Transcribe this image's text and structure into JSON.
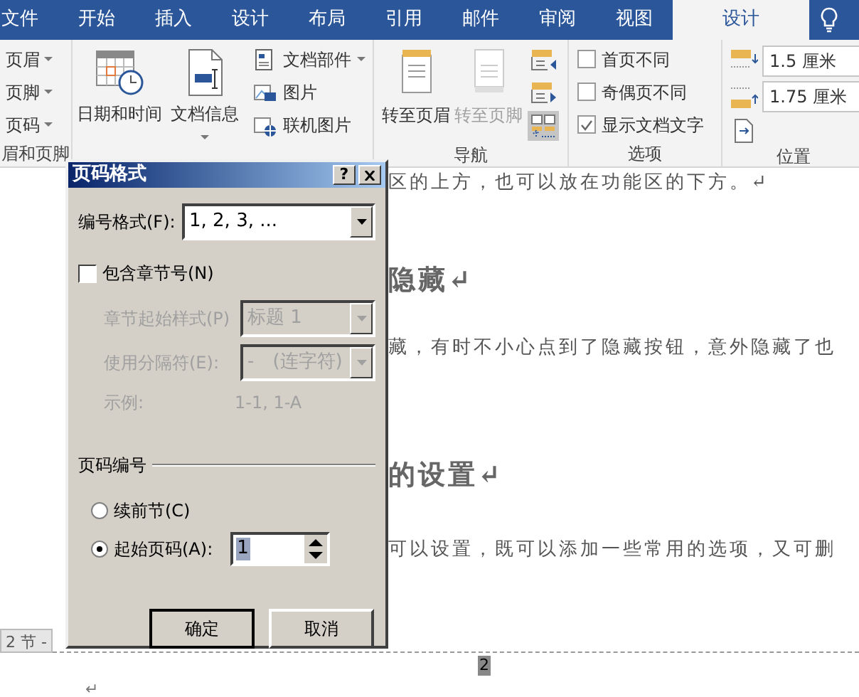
{
  "ribbon_tabs": [
    {
      "label": "文件",
      "selected": false
    },
    {
      "label": "开始",
      "selected": false
    },
    {
      "label": "插入",
      "selected": false
    },
    {
      "label": "设计",
      "selected": false
    },
    {
      "label": "布局",
      "selected": false
    },
    {
      "label": "引用",
      "selected": false
    },
    {
      "label": "邮件",
      "selected": false
    },
    {
      "label": "审阅",
      "selected": false
    },
    {
      "label": "视图",
      "selected": false
    },
    {
      "label": "设计",
      "selected": true
    }
  ],
  "header_footer_group": {
    "label": "眉和页脚",
    "items": [
      {
        "label": "页眉"
      },
      {
        "label": "页脚"
      },
      {
        "label": "页码"
      }
    ]
  },
  "insert_group": {
    "large_buttons": [
      {
        "label": "日期和时间",
        "dropdown": false
      },
      {
        "label": "文档信息",
        "dropdown": true
      }
    ],
    "small_buttons": [
      {
        "label": "文档部件",
        "dropdown": true
      },
      {
        "label": "图片",
        "dropdown": false
      },
      {
        "label": "联机图片",
        "dropdown": false
      }
    ]
  },
  "navigation_group": {
    "label": "导航",
    "buttons": [
      {
        "label": "转至页眉",
        "disabled": false
      },
      {
        "label": "转至页脚",
        "disabled": true
      }
    ],
    "small_buttons": [
      {
        "on": false
      },
      {
        "on": false
      },
      {
        "on": true
      }
    ]
  },
  "options_group": {
    "label": "选项",
    "checkboxes": [
      {
        "label": "首页不同",
        "checked": false
      },
      {
        "label": "奇偶页不同",
        "checked": false
      },
      {
        "label": "显示文档文字",
        "checked": true
      }
    ]
  },
  "position_group": {
    "label": "位置",
    "fields": [
      {
        "value": "1.5 厘米"
      },
      {
        "value": "1.75 厘米"
      }
    ]
  },
  "document": {
    "lines": [
      {
        "kind": "body",
        "text": "区的上方，也可以放在功能区的下方。↵"
      },
      {
        "kind": "heading",
        "text": "隐藏↵"
      },
      {
        "kind": "body",
        "text": "藏，有时不小心点到了隐藏按钮，意外隐藏了也"
      },
      {
        "kind": "heading",
        "text": "的设置↵"
      },
      {
        "kind": "body",
        "text": "可以设置，既可以添加一些常用的选项，又可删"
      }
    ],
    "footer": {
      "section_label": "2 节 -",
      "page_number": "2",
      "paragraph_mark": "↵"
    }
  },
  "dialog": {
    "title": "页码格式",
    "help": "?",
    "number_format": {
      "label": "编号格式(F):",
      "value": "1, 2, 3, ..."
    },
    "include_chapter": {
      "label": "包含章节号(N)",
      "checked": false
    },
    "chapter_style": {
      "label": "章节起始样式(P)",
      "value": "标题 1",
      "disabled": true
    },
    "separator": {
      "label": "使用分隔符(E):",
      "value": "-　(连字符)",
      "disabled": true
    },
    "example": {
      "label": "示例:",
      "value": "1-1, 1-A",
      "disabled": true
    },
    "numbering": {
      "label": "页码编号",
      "radios": [
        {
          "label": "续前节(C)",
          "selected": false
        },
        {
          "label": "起始页码(A):",
          "selected": true
        }
      ],
      "start_value": "1"
    },
    "buttons": [
      "确定",
      "取消"
    ]
  }
}
